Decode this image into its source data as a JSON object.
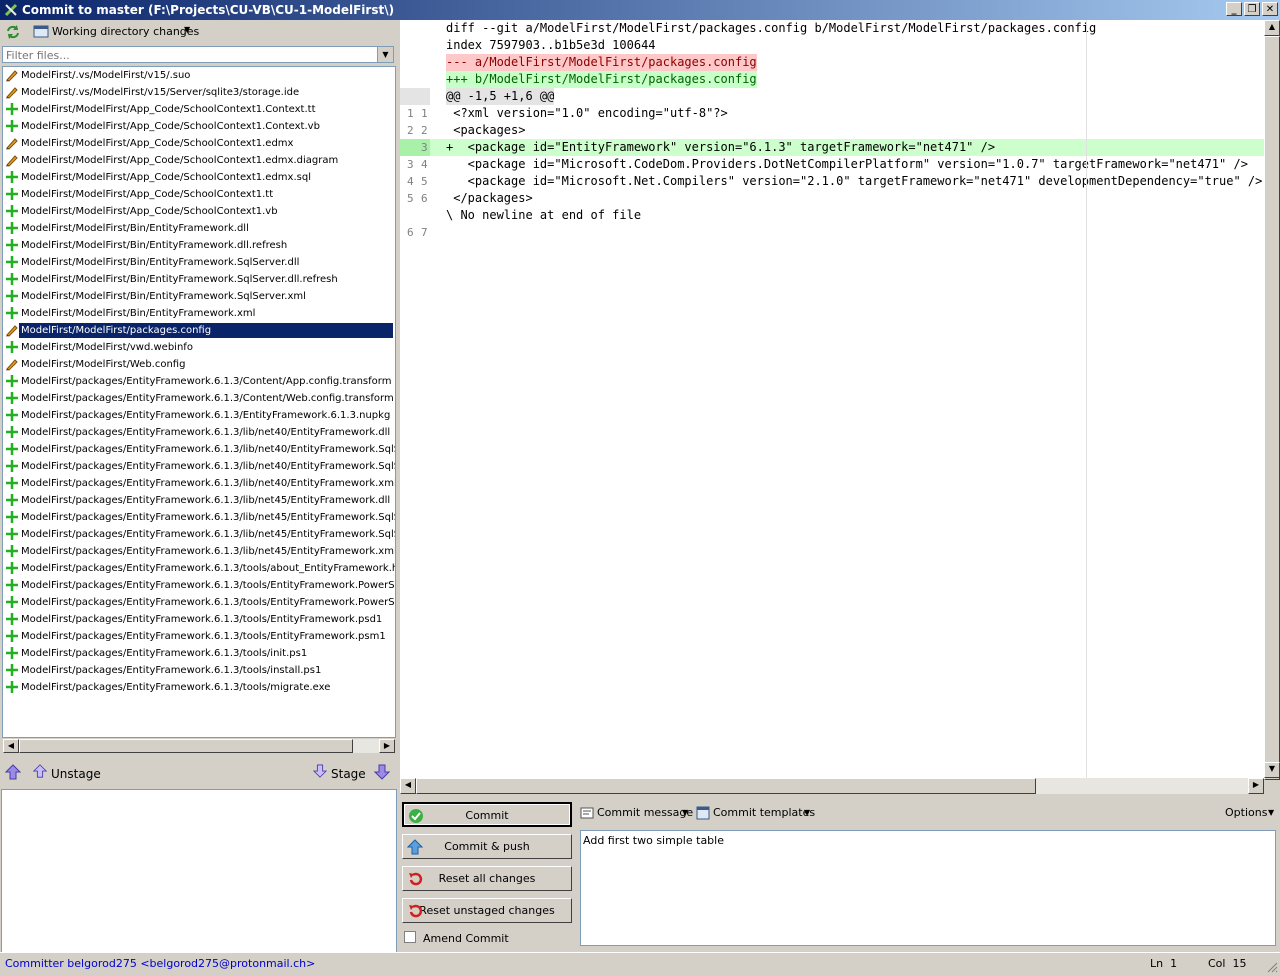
{
  "window": {
    "title": "Commit to master (F:\\Projects\\CU-VB\\CU-1-ModelFirst\\)"
  },
  "toolbar": {
    "view_label": "Working directory changes"
  },
  "filter": {
    "placeholder": "Filter files..."
  },
  "unstaged_files": [
    {
      "status": "modified",
      "path": "ModelFirst/.vs/ModelFirst/v15/.suo"
    },
    {
      "status": "modified",
      "path": "ModelFirst/.vs/ModelFirst/v15/Server/sqlite3/storage.ide"
    },
    {
      "status": "added",
      "path": "ModelFirst/ModelFirst/App_Code/SchoolContext1.Context.tt"
    },
    {
      "status": "added",
      "path": "ModelFirst/ModelFirst/App_Code/SchoolContext1.Context.vb"
    },
    {
      "status": "modified",
      "path": "ModelFirst/ModelFirst/App_Code/SchoolContext1.edmx"
    },
    {
      "status": "modified",
      "path": "ModelFirst/ModelFirst/App_Code/SchoolContext1.edmx.diagram"
    },
    {
      "status": "added",
      "path": "ModelFirst/ModelFirst/App_Code/SchoolContext1.edmx.sql"
    },
    {
      "status": "added",
      "path": "ModelFirst/ModelFirst/App_Code/SchoolContext1.tt"
    },
    {
      "status": "added",
      "path": "ModelFirst/ModelFirst/App_Code/SchoolContext1.vb"
    },
    {
      "status": "added",
      "path": "ModelFirst/ModelFirst/Bin/EntityFramework.dll"
    },
    {
      "status": "added",
      "path": "ModelFirst/ModelFirst/Bin/EntityFramework.dll.refresh"
    },
    {
      "status": "added",
      "path": "ModelFirst/ModelFirst/Bin/EntityFramework.SqlServer.dll"
    },
    {
      "status": "added",
      "path": "ModelFirst/ModelFirst/Bin/EntityFramework.SqlServer.dll.refresh"
    },
    {
      "status": "added",
      "path": "ModelFirst/ModelFirst/Bin/EntityFramework.SqlServer.xml"
    },
    {
      "status": "added",
      "path": "ModelFirst/ModelFirst/Bin/EntityFramework.xml"
    },
    {
      "status": "modified",
      "path": "ModelFirst/ModelFirst/packages.config",
      "selected": true
    },
    {
      "status": "added",
      "path": "ModelFirst/ModelFirst/vwd.webinfo"
    },
    {
      "status": "modified",
      "path": "ModelFirst/ModelFirst/Web.config"
    },
    {
      "status": "added",
      "path": "ModelFirst/packages/EntityFramework.6.1.3/Content/App.config.transform"
    },
    {
      "status": "added",
      "path": "ModelFirst/packages/EntityFramework.6.1.3/Content/Web.config.transform"
    },
    {
      "status": "added",
      "path": "ModelFirst/packages/EntityFramework.6.1.3/EntityFramework.6.1.3.nupkg"
    },
    {
      "status": "added",
      "path": "ModelFirst/packages/EntityFramework.6.1.3/lib/net40/EntityFramework.dll"
    },
    {
      "status": "added",
      "path": "ModelFirst/packages/EntityFramework.6.1.3/lib/net40/EntityFramework.SqlServer."
    },
    {
      "status": "added",
      "path": "ModelFirst/packages/EntityFramework.6.1.3/lib/net40/EntityFramework.SqlServer"
    },
    {
      "status": "added",
      "path": "ModelFirst/packages/EntityFramework.6.1.3/lib/net40/EntityFramework.xml"
    },
    {
      "status": "added",
      "path": "ModelFirst/packages/EntityFramework.6.1.3/lib/net45/EntityFramework.dll"
    },
    {
      "status": "added",
      "path": "ModelFirst/packages/EntityFramework.6.1.3/lib/net45/EntityFramework.SqlServer."
    },
    {
      "status": "added",
      "path": "ModelFirst/packages/EntityFramework.6.1.3/lib/net45/EntityFramework.SqlServer"
    },
    {
      "status": "added",
      "path": "ModelFirst/packages/EntityFramework.6.1.3/lib/net45/EntityFramework.xml"
    },
    {
      "status": "added",
      "path": "ModelFirst/packages/EntityFramework.6.1.3/tools/about_EntityFramework.help.tx"
    },
    {
      "status": "added",
      "path": "ModelFirst/packages/EntityFramework.6.1.3/tools/EntityFramework.PowerShell.dl"
    },
    {
      "status": "added",
      "path": "ModelFirst/packages/EntityFramework.6.1.3/tools/EntityFramework.PowerShell.Uti"
    },
    {
      "status": "added",
      "path": "ModelFirst/packages/EntityFramework.6.1.3/tools/EntityFramework.psd1"
    },
    {
      "status": "added",
      "path": "ModelFirst/packages/EntityFramework.6.1.3/tools/EntityFramework.psm1"
    },
    {
      "status": "added",
      "path": "ModelFirst/packages/EntityFramework.6.1.3/tools/init.ps1"
    },
    {
      "status": "added",
      "path": "ModelFirst/packages/EntityFramework.6.1.3/tools/install.ps1"
    },
    {
      "status": "added",
      "path": "ModelFirst/packages/EntityFramework.6.1.3/tools/migrate.exe"
    }
  ],
  "stage": {
    "unstage_label": "Unstage",
    "stage_label": "Stage"
  },
  "diff": [
    {
      "old": "",
      "new": "",
      "kind": "header",
      "text": "diff --git a/ModelFirst/ModelFirst/packages.config b/ModelFirst/ModelFirst/packages.config"
    },
    {
      "old": "",
      "new": "",
      "kind": "header",
      "text": "index 7597903..b1b5e3d 100644"
    },
    {
      "old": "",
      "new": "",
      "kind": "remfile",
      "text": "--- a/ModelFirst/ModelFirst/packages.config"
    },
    {
      "old": "",
      "new": "",
      "kind": "addfile",
      "text": "+++ b/ModelFirst/ModelFirst/packages.config"
    },
    {
      "old": "",
      "new": "",
      "kind": "hunk",
      "text": "@@ -1,5 +1,6 @@"
    },
    {
      "old": "1",
      "new": "1",
      "kind": "ctx",
      "text": " <?xml version=\"1.0\" encoding=\"utf-8\"?>"
    },
    {
      "old": "2",
      "new": "2",
      "kind": "ctx",
      "text": " <packages>"
    },
    {
      "old": "",
      "new": "3",
      "kind": "add",
      "text": "+  <package id=\"EntityFramework\" version=\"6.1.3\" targetFramework=\"net471\" />"
    },
    {
      "old": "3",
      "new": "4",
      "kind": "ctx",
      "text": "   <package id=\"Microsoft.CodeDom.Providers.DotNetCompilerPlatform\" version=\"1.0.7\" targetFramework=\"net471\" />"
    },
    {
      "old": "4",
      "new": "5",
      "kind": "ctx",
      "text": "   <package id=\"Microsoft.Net.Compilers\" version=\"2.1.0\" targetFramework=\"net471\" developmentDependency=\"true\" />"
    },
    {
      "old": "5",
      "new": "6",
      "kind": "ctx",
      "text": " </packages>"
    },
    {
      "old": "",
      "new": "",
      "kind": "nonl",
      "text": "\\ No newline at end of file"
    },
    {
      "old": "6",
      "new": "7",
      "kind": "ctx",
      "text": ""
    }
  ],
  "commit": {
    "commit_label": "Commit",
    "commit_push_label": "Commit & push",
    "reset_all_label": "Reset all changes",
    "reset_unstaged_label": "Reset unstaged changes",
    "amend_label": "Amend Commit",
    "amend_checked": false,
    "message_menu": "Commit message",
    "templates_menu": "Commit templates",
    "options_menu": "Options",
    "message": "Add first two simple table"
  },
  "status": {
    "committer": "Committer belgorod275 <belgorod275@protonmail.ch>",
    "ln_label": "Ln",
    "ln": "1",
    "col_label": "Col",
    "col": "15"
  }
}
